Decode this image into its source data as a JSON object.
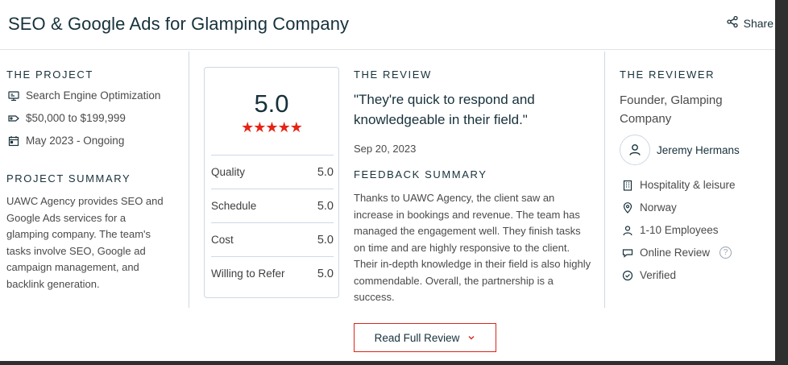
{
  "header": {
    "title": "SEO & Google Ads for Glamping Company",
    "share_label": "Share"
  },
  "project": {
    "label": "THE PROJECT",
    "service": "Search Engine Optimization",
    "budget": "$50,000 to $199,999",
    "dates": "May 2023 - Ongoing",
    "summary_label": "PROJECT SUMMARY",
    "summary": "UAWC Agency provides SEO and Google Ads services for a glamping company. The team's tasks involve SEO, Google ad campaign management, and backlink generation."
  },
  "rating": {
    "overall": "5.0",
    "stars": "★★★★★",
    "star_count": 5,
    "rows": [
      {
        "label": "Quality",
        "value": "5.0"
      },
      {
        "label": "Schedule",
        "value": "5.0"
      },
      {
        "label": "Cost",
        "value": "5.0"
      },
      {
        "label": "Willing to Refer",
        "value": "5.0"
      }
    ]
  },
  "review": {
    "label": "THE REVIEW",
    "quote": "\"They're quick to respond and knowledgeable in their field.\"",
    "date": "Sep 20, 2023",
    "feedback_label": "FEEDBACK SUMMARY",
    "feedback": "Thanks to UAWC Agency, the client saw an increase in bookings and revenue. The team has managed the engagement well. They finish tasks on time and are highly responsive to the client. Their in-depth knowledge in their field is also highly commendable. Overall, the partnership is a success.",
    "read_full_label": "Read Full Review"
  },
  "reviewer": {
    "label": "THE REVIEWER",
    "role": "Founder, Glamping Company",
    "name": "Jeremy Hermans",
    "industry": "Hospitality & leisure",
    "location": "Norway",
    "employees": "1-10 Employees",
    "review_type": "Online Review",
    "help_glyph": "?",
    "verified": "Verified"
  },
  "colors": {
    "accent_red": "#e62415",
    "title_navy": "#17313b",
    "divider": "#cfd8e3"
  }
}
